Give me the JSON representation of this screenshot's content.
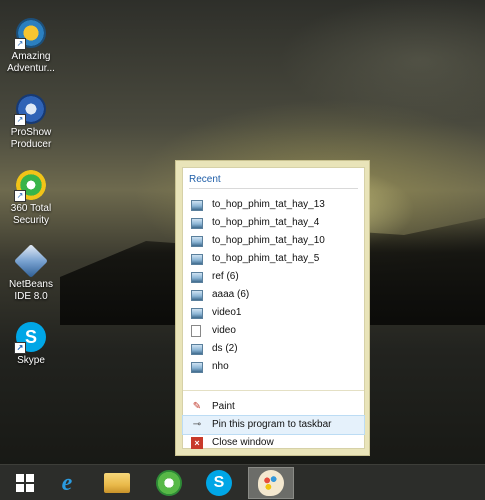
{
  "desktop": {
    "icons": [
      {
        "label": "Amazing Adventur...",
        "icon": "amazing-adventures-icon"
      },
      {
        "label": "ProShow Producer",
        "icon": "proshow-producer-icon"
      },
      {
        "label": "360 Total Security",
        "icon": "360-total-security-icon"
      },
      {
        "label": "NetBeans IDE 8.0",
        "icon": "netbeans-ide-icon"
      },
      {
        "label": "Skype",
        "icon": "skype-icon"
      }
    ]
  },
  "jumplist": {
    "recent_title": "Recent",
    "recent_items": [
      {
        "label": "to_hop_phim_tat_hay_13",
        "icon": "image-file-icon"
      },
      {
        "label": "to_hop_phim_tat_hay_4",
        "icon": "image-file-icon"
      },
      {
        "label": "to_hop_phim_tat_hay_10",
        "icon": "image-file-icon"
      },
      {
        "label": "to_hop_phim_tat_hay_5",
        "icon": "image-file-icon"
      },
      {
        "label": "ref (6)",
        "icon": "image-file-icon"
      },
      {
        "label": "aaaa (6)",
        "icon": "image-file-icon"
      },
      {
        "label": "video1",
        "icon": "image-file-icon"
      },
      {
        "label": "video",
        "icon": "document-file-icon"
      },
      {
        "label": "ds (2)",
        "icon": "image-file-icon"
      },
      {
        "label": "nho",
        "icon": "image-file-icon"
      }
    ],
    "tasks": [
      {
        "label": "Paint",
        "icon": "paint-icon"
      },
      {
        "label": "Pin this program to taskbar",
        "icon": "pin-icon",
        "highlighted": true
      },
      {
        "label": "Close window",
        "icon": "close-icon"
      }
    ]
  },
  "taskbar": {
    "buttons": [
      {
        "name": "start",
        "icon": "windows-logo-icon"
      },
      {
        "name": "internet-explorer",
        "icon": "internet-explorer-icon",
        "glyph": "e"
      },
      {
        "name": "file-explorer",
        "icon": "folder-icon"
      },
      {
        "name": "coccoc-browser",
        "icon": "browser-icon"
      },
      {
        "name": "skype",
        "icon": "skype-icon",
        "glyph": "S"
      },
      {
        "name": "paint",
        "icon": "paint-palette-icon",
        "active": true
      }
    ]
  },
  "colors": {
    "jumplist_frame": "#e9e4b9",
    "section_title": "#1f5ea8",
    "highlight": "#e5f1fb",
    "taskbar": "#2c2d2a",
    "active_button": "#6c6d69"
  }
}
